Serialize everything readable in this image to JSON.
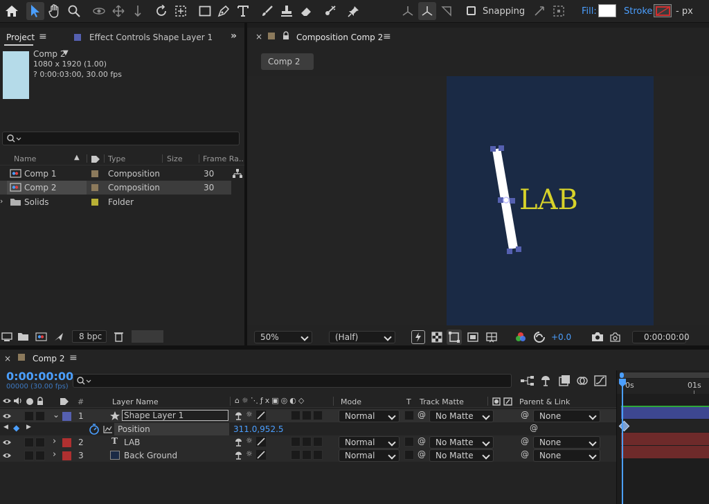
{
  "toolbar": {
    "snapping_label": "Snapping",
    "fill_label": "Fill:",
    "stroke_label": "Stroke:",
    "stroke_unit": "- px",
    "fill_color": "#ffffff",
    "icons": [
      "home-icon",
      "selection-tool-icon",
      "hand-tool-icon",
      "zoom-tool-icon",
      "orbit-camera-icon",
      "pan-camera-icon",
      "dolly-camera-icon",
      "rotate-tool-icon",
      "pan-behind-icon",
      "rectangle-tool-icon",
      "pen-tool-icon",
      "type-tool-icon",
      "brush-tool-icon",
      "clone-stamp-icon",
      "eraser-icon",
      "roto-brush-icon",
      "puppet-pin-icon"
    ]
  },
  "project_panel": {
    "tab_project": "Project",
    "tab_effect_controls": "Effect Controls Shape Layer 1",
    "comp_name": "Comp 2",
    "comp_size": "1080 x 1920 (1.00)",
    "comp_duration": "? 0:00:03:00, 30.00 fps",
    "columns": [
      "Name",
      "Type",
      "Size",
      "Frame Ra..."
    ],
    "items": [
      {
        "name": "Comp 1",
        "type": "Composition",
        "frame_rate": "30",
        "label_color": "#8c7a5c"
      },
      {
        "name": "Comp 2",
        "type": "Composition",
        "frame_rate": "30",
        "label_color": "#8c7a5c"
      },
      {
        "name": "Solids",
        "type": "Folder",
        "frame_rate": "",
        "label_color": "#b8b035"
      }
    ],
    "bpc": "8 bpc"
  },
  "composition_panel": {
    "tab_label": "Composition Comp 2",
    "breadcrumb": "Comp 2",
    "canvas_text": "LAB",
    "zoom": "50%",
    "resolution": "(Half)",
    "exposure": "+0.0",
    "timecode": "0:00:00:00",
    "canvas_color": "#1a2a45",
    "text_color": "#d7d22a"
  },
  "timeline_panel": {
    "tab_label": "Comp 2",
    "timecode": "0:00:00:00",
    "frame_info": "00000 (30.00 fps)",
    "columns": {
      "layer_name": "Layer Name",
      "mode": "Mode",
      "t": "T",
      "track_matte": "Track Matte",
      "parent": "Parent & Link"
    },
    "ruler": [
      "0s",
      "01s"
    ],
    "layers": [
      {
        "num": "1",
        "name": "Shape Layer 1",
        "mode": "Normal",
        "matte": "No Matte",
        "parent": "None",
        "label_color": "#5560b0"
      },
      {
        "num": "2",
        "name": "LAB",
        "mode": "Normal",
        "matte": "No Matte",
        "parent": "None",
        "label_color": "#b03030"
      },
      {
        "num": "3",
        "name": "Back Ground",
        "mode": "Normal",
        "matte": "No Matte",
        "parent": "None",
        "label_color": "#b03030"
      }
    ],
    "property": {
      "name": "Position",
      "value": "311.0,952.5"
    }
  }
}
